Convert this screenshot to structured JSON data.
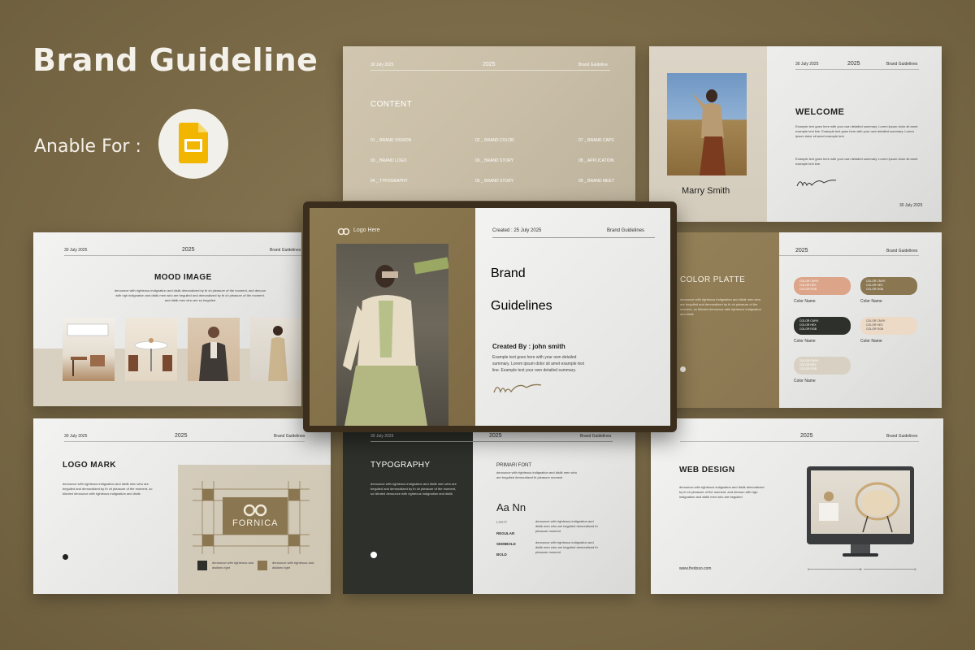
{
  "header": {
    "title": "Brand  Guideline",
    "available_label": "Anable For :"
  },
  "icons": {
    "app": "google-slides-icon"
  },
  "colors": {
    "background": "#7a6a47",
    "accent": "#8a7650",
    "dark": "#2d302b",
    "slides_yellow": "#f2b600"
  },
  "common": {
    "date": "30 July 2025",
    "year": "2025",
    "brand": "Brand Guidelines",
    "brand_guideline_small": "Brand Guideline",
    "num": "0"
  },
  "content_slide": {
    "title": "CONTENT",
    "items": [
      "01 _ BRAND VISSION",
      "02 _ BRAND COLOR",
      "07 _ BRAND CAPS",
      "03 _ BRAND LOGO",
      "06 _ BRAND STORY",
      "08 _ APPLICATION",
      "04 _ TYPOGRAPHY",
      "05 _ BRAND STORY",
      "09 _ BRAND MEET"
    ]
  },
  "welcome_slide": {
    "title": "WELCOME",
    "name": "Marry Smith",
    "paragraphs": [
      "Example text goes here with your own detailed summary. Lorem ipsum dolor sit amet example text line. Example text goes here with your own detailed summary. Lorem ipsum dolor sit amet example text.",
      "Example text goes here with your own detailed summary. Lorem ipsum dolor sit amet example text line."
    ],
    "date": "30 July 2025"
  },
  "mood_slide": {
    "title": "MOOD IMAGE",
    "text": "denounce with righteous indignation and dislik demoralized by th ch pleasure of the moment, and denoun with righ indignation and dislik men who are beguiled and demoralized by th ch pleasure of the moment. and dislik men who are so beguiled"
  },
  "center_slide": {
    "logo_text": "Logo Here",
    "created": "Created : 25 July 2025",
    "brand": "Brand Guidelines",
    "title_line1": "Brand",
    "title_line2": "Guidelines",
    "created_by": "Created By : john smith",
    "summary": "Example text goes here with your own detailed summary. Lorem ipsum dolor sit amet example text line. Example text your own detailed summary."
  },
  "color_slide": {
    "title": "COLOR PLATTE",
    "text": "denounce with righteous indignation and dislik men who are beguiled and demoralized by th ch pleasure of the moment, so blinded denounce with righteous indignation and dislik",
    "label": "Color Name",
    "code_lines": [
      "COLOR CMYK",
      "COLOR HEX",
      "COLOR RGB"
    ],
    "swatches": [
      "#dca489",
      "#8a7650",
      "#2d302b",
      "#ecd9c6",
      "#d8d0c2"
    ]
  },
  "logo_slide": {
    "title": "LOGO MARK",
    "text": "denounce with righteous indignation and dislik men who are beguiled and demoralized by th ch pleasure of the moment, so blinded denounce with righteous indignation and dislik",
    "logo_name": "FORNICA",
    "legend1": "denounce with righteous and dislikes right",
    "legend2": "denounce with righteous and dislikes right"
  },
  "typo_slide": {
    "title": "TYPOGRAPHY",
    "text": "denounce with righteous indignation and dislik men who are beguiled and demoralized by th ch pleasure of the moment, so blinded denounce with righteous indignation and dislik",
    "font_title": "PRIMARI FONT",
    "font_text": "denounce with righteous indignation and dislik men who are beguiled demoralized th pleasure moment",
    "sample": "Aa Nn",
    "weights": [
      "LIGHT",
      "REGULAR",
      "SEMIBOLD",
      "BOLD"
    ],
    "weight_text": "denounce with righteous indignation and dislik men who are beguiled demoralized th pleasure moment"
  },
  "web_slide": {
    "title": "WEB DESIGN",
    "text": "denounce with righteous indignation and dislik demoralized by th ch pleasure of the moment, and denoun with righ indignation and dislik men who are beguiled",
    "url": "www.fredoso.com",
    "nav1": "X",
    "nav2": "X",
    "nav3": "X"
  }
}
